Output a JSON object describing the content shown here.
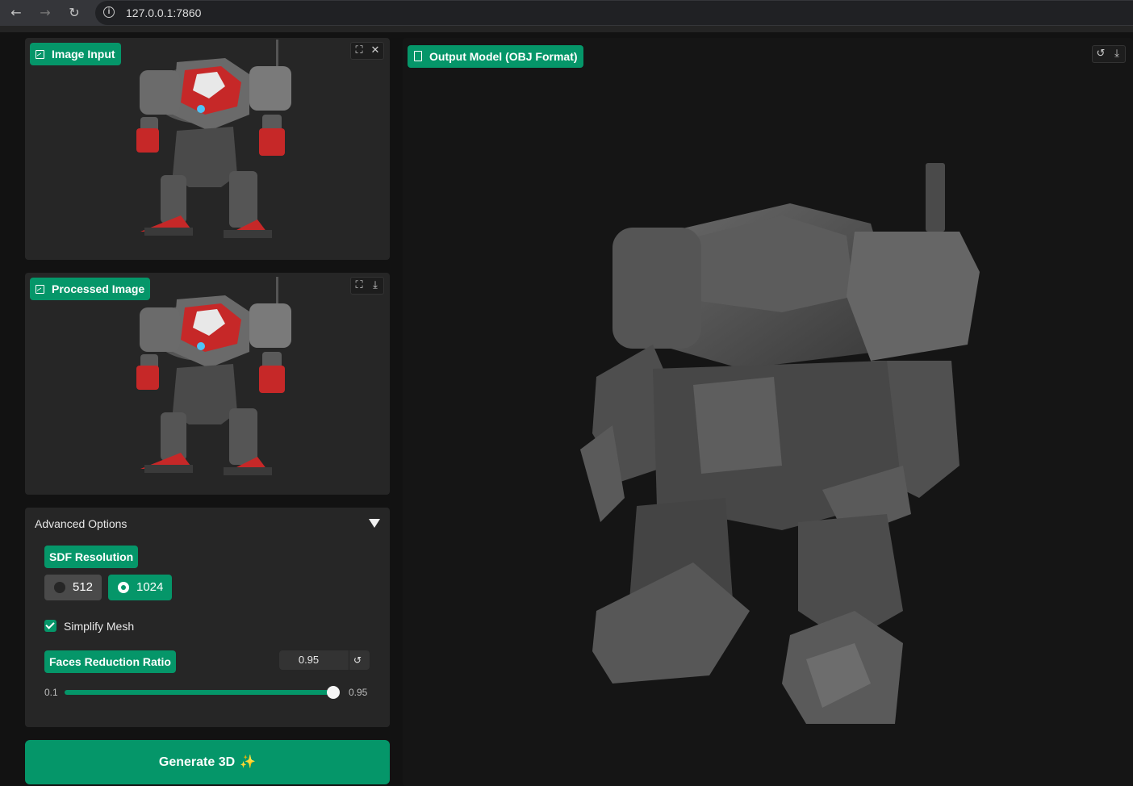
{
  "browser": {
    "url": "127.0.0.1:7860",
    "back_icon": "arrow-left-icon",
    "forward_icon": "arrow-right-icon",
    "reload_icon": "reload-icon",
    "info_icon": "info-icon"
  },
  "image_input": {
    "label": "Image Input",
    "tools": [
      "fullscreen-icon",
      "close-icon"
    ]
  },
  "processed_image": {
    "label": "Processed Image",
    "tools": [
      "fullscreen-icon",
      "download-icon"
    ]
  },
  "advanced": {
    "title": "Advanced Options",
    "sdf_label": "SDF Resolution",
    "sdf_options": [
      "512",
      "1024"
    ],
    "sdf_selected": "1024",
    "simplify_label": "Simplify Mesh",
    "simplify_checked": true,
    "faces_label": "Faces Reduction Ratio",
    "faces_value": "0.95",
    "slider_min": "0.1",
    "slider_max": "0.95",
    "slider_fraction": 1.0
  },
  "generate_label": "Generate 3D",
  "output": {
    "label": "Output Model (OBJ Format)",
    "tools": [
      "undo-icon",
      "download-icon"
    ]
  },
  "colors": {
    "accent": "#059669",
    "panel": "#262626",
    "background": "#121212"
  }
}
